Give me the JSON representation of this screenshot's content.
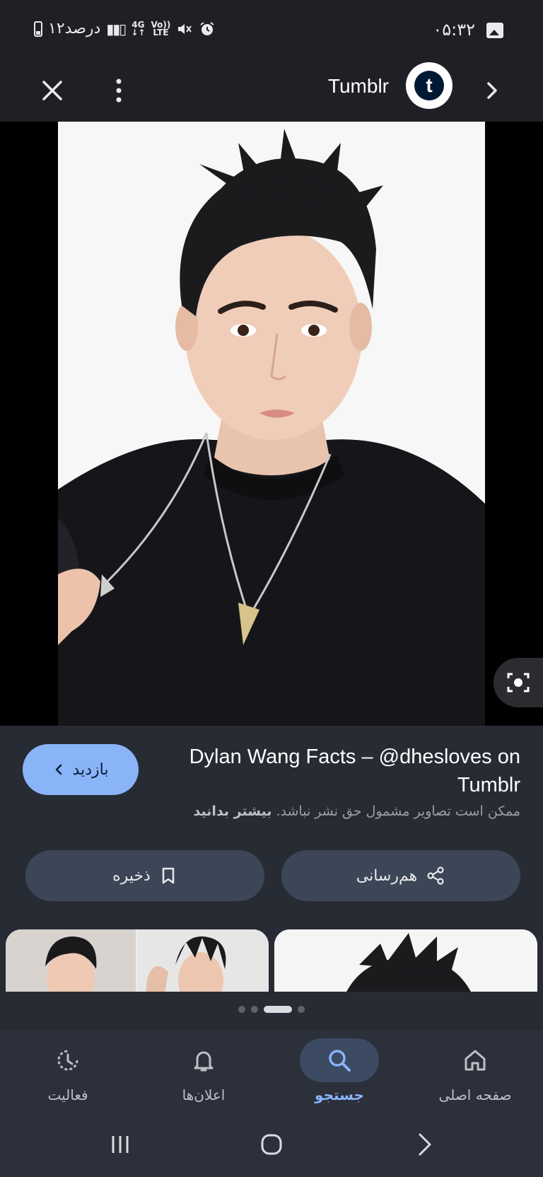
{
  "status_bar": {
    "time": "۰۵:۳۲",
    "battery": "۱۲درصد",
    "network": "4G",
    "volte": "Vo)) LTE"
  },
  "top_bar": {
    "source_title": "Tumblr",
    "logo_letter": "t"
  },
  "info": {
    "title": "Dylan Wang Facts – @dhesloves on Tumblr",
    "notice_text": "ممکن است تصاویر مشمول حق نشر نباشد.",
    "notice_link": "بیشتر بدانید",
    "visit_label": "بازدید",
    "share_label": "هم‌رسانی",
    "save_label": "ذخیره"
  },
  "bottom_nav": [
    {
      "label": "صفحه اصلی",
      "icon": "home-icon"
    },
    {
      "label": "جستجو",
      "icon": "search-icon"
    },
    {
      "label": "اعلان‌ها",
      "icon": "bell-icon"
    },
    {
      "label": "فعالیت",
      "icon": "history-icon"
    }
  ],
  "colors": {
    "accent": "#8ab4f8",
    "panel": "#272b34",
    "pill": "#3c4656",
    "nav_bg": "#2b303b"
  }
}
